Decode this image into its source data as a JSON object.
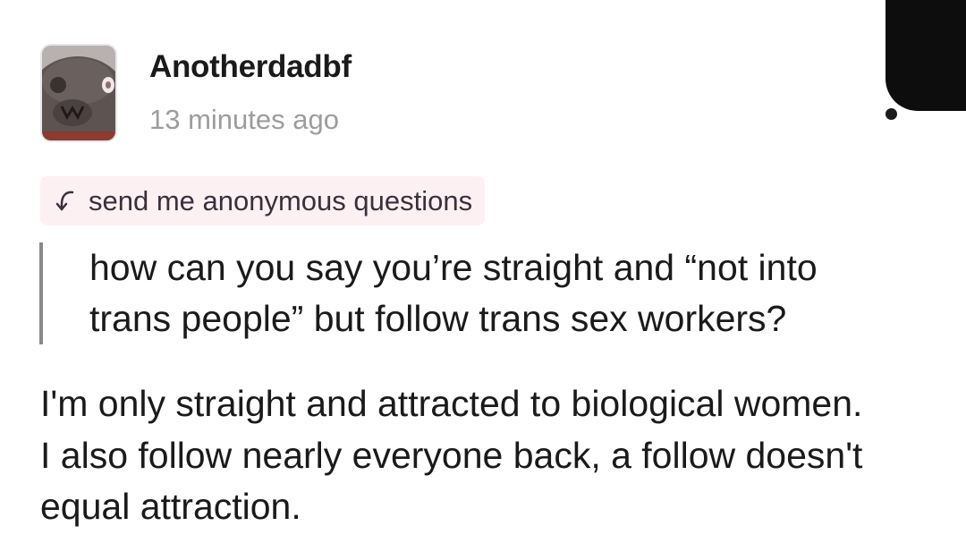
{
  "post": {
    "author": "Anotherdadbf",
    "timestamp": "13 minutes ago",
    "ask_link": "send me anonymous questions",
    "question": "how can you say you’re straight and “not into trans people” but follow trans sex workers?",
    "answer": "I'm only straight and attracted to biological women. I also follow nearly everyone back, a follow doesn't equal attraction."
  },
  "icons": {
    "avatar": "seal-photo-avatar",
    "ask_arrow": "curved-arrow-down-left-icon"
  },
  "colors": {
    "ask_chip_background": "#fdf0f3",
    "timestamp": "#9c9c9c",
    "quote_bar": "#8a8a8a",
    "text": "#1a1a1a"
  }
}
